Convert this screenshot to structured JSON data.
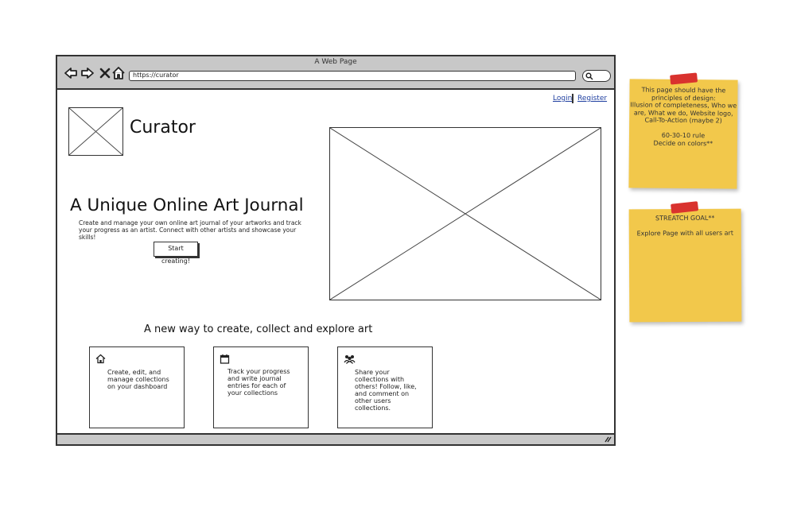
{
  "browser": {
    "window_title": "A Web Page",
    "url": "https://curator",
    "icons": [
      "back-arrow-icon",
      "forward-arrow-icon",
      "close-icon",
      "home-icon",
      "search-icon"
    ]
  },
  "header": {
    "login": "Login",
    "register": "Register",
    "site_name": "Curator"
  },
  "hero": {
    "title": "A Unique Online Art Journal",
    "description": "Create and manage your own online art journal of your artworks and track your progress as an artist. Connect with other artists and showcase your skills!",
    "cta": "Start creating!"
  },
  "features": {
    "heading": "A new way to create, collect and explore art",
    "cards": [
      {
        "icon": "home-icon",
        "text": "Create, edit, and manage collections on your dashboard"
      },
      {
        "icon": "calendar-icon",
        "text": "Track your progress and write journal entries for each of your collections"
      },
      {
        "icon": "users-icon",
        "text": "Share your collections with others! Follow, like, and comment on other users collections."
      }
    ]
  },
  "notes": [
    {
      "lines": [
        "This page should have the",
        "principles of design:",
        "Illusion of completeness, Who we",
        "are, What we do, Website logo,",
        "Call-To-Action (maybe 2)",
        "",
        "60-30-10 rule",
        "Decide on colors**"
      ]
    },
    {
      "lines": [
        "STREATCH GOAL**",
        "",
        "Explore Page with all users art"
      ]
    }
  ],
  "colors": {
    "sticky": "#f2c84b",
    "tape": "#d9322e",
    "chrome": "#c8c8c8",
    "link": "#1f3fa0"
  }
}
